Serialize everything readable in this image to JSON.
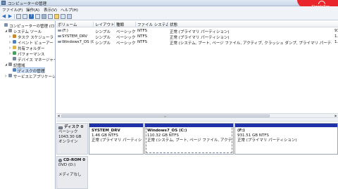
{
  "window": {
    "title": "コンピューターの管理"
  },
  "brand": {
    "text": "SimpleTap",
    "color": "#e8262b"
  },
  "menu": {
    "items": [
      "ファイル(F)",
      "操作(A)",
      "表示(V)",
      "ヘルプ(H)"
    ]
  },
  "toolbar": {
    "back": "◀",
    "forward": "▶",
    "help": "?"
  },
  "tree": {
    "items": [
      {
        "label": "コンピューターの管理 (ローカル)",
        "icon": "computer-management-icon",
        "level": 0,
        "expander": ""
      },
      {
        "label": "システム ツール",
        "icon": "tools-icon",
        "level": 1,
        "expander": "◢"
      },
      {
        "label": "タスク スケジューラ",
        "icon": "clock-icon",
        "level": 2,
        "expander": "▷"
      },
      {
        "label": "イベント ビューアー",
        "icon": "event-viewer-icon",
        "level": 2,
        "expander": "▷"
      },
      {
        "label": "共有フォルダー",
        "icon": "shared-folder-icon",
        "level": 2,
        "expander": "▷"
      },
      {
        "label": "パフォーマンス",
        "icon": "performance-icon",
        "level": 2,
        "expander": "▷"
      },
      {
        "label": "デバイス マネージャー",
        "icon": "device-manager-icon",
        "level": 2,
        "expander": ""
      },
      {
        "label": "記憶域",
        "icon": "storage-icon",
        "level": 1,
        "expander": "◢"
      },
      {
        "label": "ディスクの管理",
        "icon": "disk-management-icon",
        "level": 2,
        "expander": "",
        "selected": true
      },
      {
        "label": "サービスとアプリケーション",
        "icon": "services-icon",
        "level": 1,
        "expander": "▷"
      }
    ]
  },
  "volumes": {
    "columns": [
      "ボリューム",
      "レイアウト",
      "種類",
      "ファイル システム",
      "状態"
    ],
    "rows": [
      [
        "(F:)",
        "シンプル",
        "ベーシック",
        "NTFS",
        "正常 (プライマリ パーティション)"
      ],
      [
        "SYSTEM_DRV",
        "シンプル",
        "ベーシック",
        "NTFS",
        "正常 (プライマリ パーティション)"
      ],
      [
        "Windows7_OS (C:)",
        "シンプル",
        "ベーシック",
        "NTFS",
        "正常 (システム, ブート, ページ ファイル, アクティブ, クラッシュ ダンプ, プライマリ パーティション)"
      ]
    ],
    "right_edge": [
      "93",
      "1.",
      "1."
    ]
  },
  "scrollbar": {
    "left": "◀",
    "right": "▶",
    "grip": "III"
  },
  "disks": [
    {
      "name": "ディスク 0",
      "type": "ベーシック",
      "size": "1043.30 GB",
      "status": "オンライン",
      "partitions": [
        {
          "name": "SYSTEM_DRV",
          "size": "1.46 GB NTFS",
          "status": "正常 (プライマリ パーティション)",
          "bar_color": "#1f31a8"
        },
        {
          "name": "Windows7_OS  (C:)",
          "size": "110.32 GB NTFS",
          "status": "正常 (システム, ブート, ページ ファイル, アクティブ",
          "bar_color": "#1f31a8"
        },
        {
          "name": "(F:)",
          "size": "931.51 GB NTFS",
          "status": "正常 (プライマリ パーティション)",
          "bar_color": "#1f31a8"
        }
      ]
    },
    {
      "name": "CD-ROM 0",
      "type": "DVD (D:)",
      "size": "",
      "status": "メディアなし",
      "partitions": []
    }
  ]
}
